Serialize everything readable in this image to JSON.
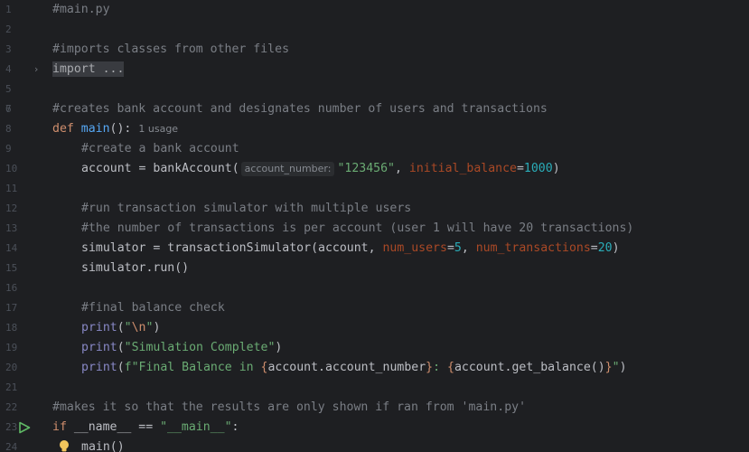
{
  "editor": {
    "file_comment": "#main.py",
    "imports_comment": "#imports classes from other files",
    "import_fold": "import ...",
    "create_comment": "#creates bank account and designates number of users and transactions",
    "def_kw": "def",
    "main_name": "main",
    "main_parens": "():",
    "usage_hint": "1 usage",
    "create_account_comment": "#create a bank account",
    "account_lhs": "account = bankAccount(",
    "inlay_account_number": "account_number:",
    "account_number_value": "\"123456\"",
    "comma_sep": ", ",
    "initial_balance_param": "initial_balance",
    "eq": "=",
    "balance_value": "1000",
    "close_paren": ")",
    "run_comment": "#run transaction simulator with multiple users",
    "tx_comment": "#the number of transactions is per account (user 1 will have 20 transactions)",
    "sim_lhs": "simulator = transactionSimulator(account, ",
    "num_users_param": "num_users",
    "num_users_value": "5",
    "num_tx_param": "num_transactions",
    "num_tx_value": "20",
    "sim_run": "simulator.run()",
    "final_comment": "#final balance check",
    "print_kw": "print",
    "open_paren": "(",
    "quote": "\"",
    "newline_escape": "\\n",
    "sim_complete_str": "\"Simulation Complete\"",
    "fstr_prefix": "f\"Final Balance in ",
    "brace_open": "{",
    "brace_close": "}",
    "account_number_expr": "account.account_number",
    "colon_sep": ": ",
    "balance_expr": "account.get_balance()",
    "fstr_end": "\"",
    "results_comment": "#makes it so that the results are only shown if ran from 'main.py'",
    "if_kw": "if",
    "dunder_name": " __name__ == ",
    "dunder_main_str": "\"__main__\"",
    "colon": ":",
    "main_call": "main()",
    "line_numbers": [
      "1",
      "2",
      "3",
      "4",
      "5",
      "6",
      "7",
      "8",
      "9",
      "10",
      "11",
      "12",
      "13",
      "14",
      "15",
      "16",
      "17",
      "18",
      "19",
      "20",
      "21",
      "22",
      "23",
      "24"
    ]
  },
  "colors": {
    "background": "#1e1f22",
    "comment": "#7a7e85",
    "keyword": "#cf8e6d",
    "function": "#56a8f5",
    "string": "#6aab73",
    "number": "#2aacb8",
    "param": "#aa4926",
    "builtin": "#8888c6",
    "run_icon": "#5fb865",
    "bulb_icon": "#f2c55c"
  },
  "icons": {
    "fold_arrow": "chevron-right-icon",
    "run": "run-play-icon",
    "bulb": "lightbulb-icon"
  }
}
